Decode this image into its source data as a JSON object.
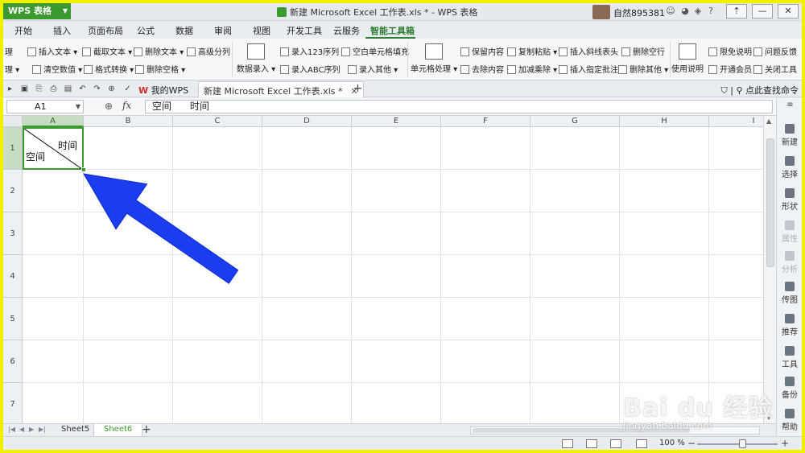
{
  "titlebar": {
    "app_button": "WPS 表格",
    "title": "新建 Microsoft Excel 工作表.xls * - WPS 表格",
    "user_name": "自然895381",
    "minimize": "—",
    "restore": "❐",
    "close": "✕"
  },
  "ribbon_tabs": [
    "开始",
    "插入",
    "页面布局",
    "公式",
    "数据",
    "审阅",
    "视图",
    "开发工具",
    "云服务",
    "智能工具箱"
  ],
  "ribbon": {
    "g1": [
      "理",
      "插入文本",
      "截取文本",
      "删除文本",
      "高级分列",
      "清空数值",
      "格式转换",
      "删除空格"
    ],
    "data_entry": "数据录入",
    "g2": [
      "录入123序列",
      "空白单元格填充",
      "录入ABC序列",
      "录入其他"
    ],
    "cell_process": "单元格处理",
    "g3": [
      "保留内容",
      "复制粘贴",
      "插入斜线表头",
      "删除空行",
      "去除内容",
      "加减乘除",
      "插入指定批注",
      "删除其他"
    ],
    "usage": "使用说明",
    "g4": [
      "限免说明",
      "问题反馈",
      "开通会员",
      "关闭工具"
    ]
  },
  "doc_tabs": {
    "my_wps": "我的WPS",
    "active_doc": "新建 Microsoft Excel 工作表.xls *",
    "search_cmd": "点此查找命令"
  },
  "formula_bar": {
    "name_box": "A1",
    "fx": "fx",
    "content": "空间      时间"
  },
  "grid": {
    "columns": [
      "A",
      "B",
      "C",
      "D",
      "E",
      "F",
      "G",
      "H",
      "I"
    ],
    "rows": [
      "1",
      "2",
      "3",
      "4",
      "5",
      "6",
      "7"
    ],
    "a1_top_right": "时间",
    "a1_bottom_left": "空间"
  },
  "right_pane": [
    {
      "label": "新建",
      "enabled": true
    },
    {
      "label": "选择",
      "enabled": true
    },
    {
      "label": "形状",
      "enabled": true
    },
    {
      "label": "属性",
      "enabled": false
    },
    {
      "label": "分析",
      "enabled": false
    },
    {
      "label": "传图",
      "enabled": true
    },
    {
      "label": "推荐",
      "enabled": true
    },
    {
      "label": "工具",
      "enabled": true
    },
    {
      "label": "备份",
      "enabled": true
    },
    {
      "label": "帮助",
      "enabled": true
    }
  ],
  "sheets": [
    "Sheet5",
    "Sheet6"
  ],
  "active_sheet": "Sheet6",
  "status": {
    "zoom": "100 %"
  },
  "watermark": {
    "logo": "Bai du 经验",
    "url": "jingyan.baidu.com"
  },
  "colors": {
    "accent": "#3a9a30",
    "frame": "#f0f000",
    "arrow": "#1a3df0"
  }
}
